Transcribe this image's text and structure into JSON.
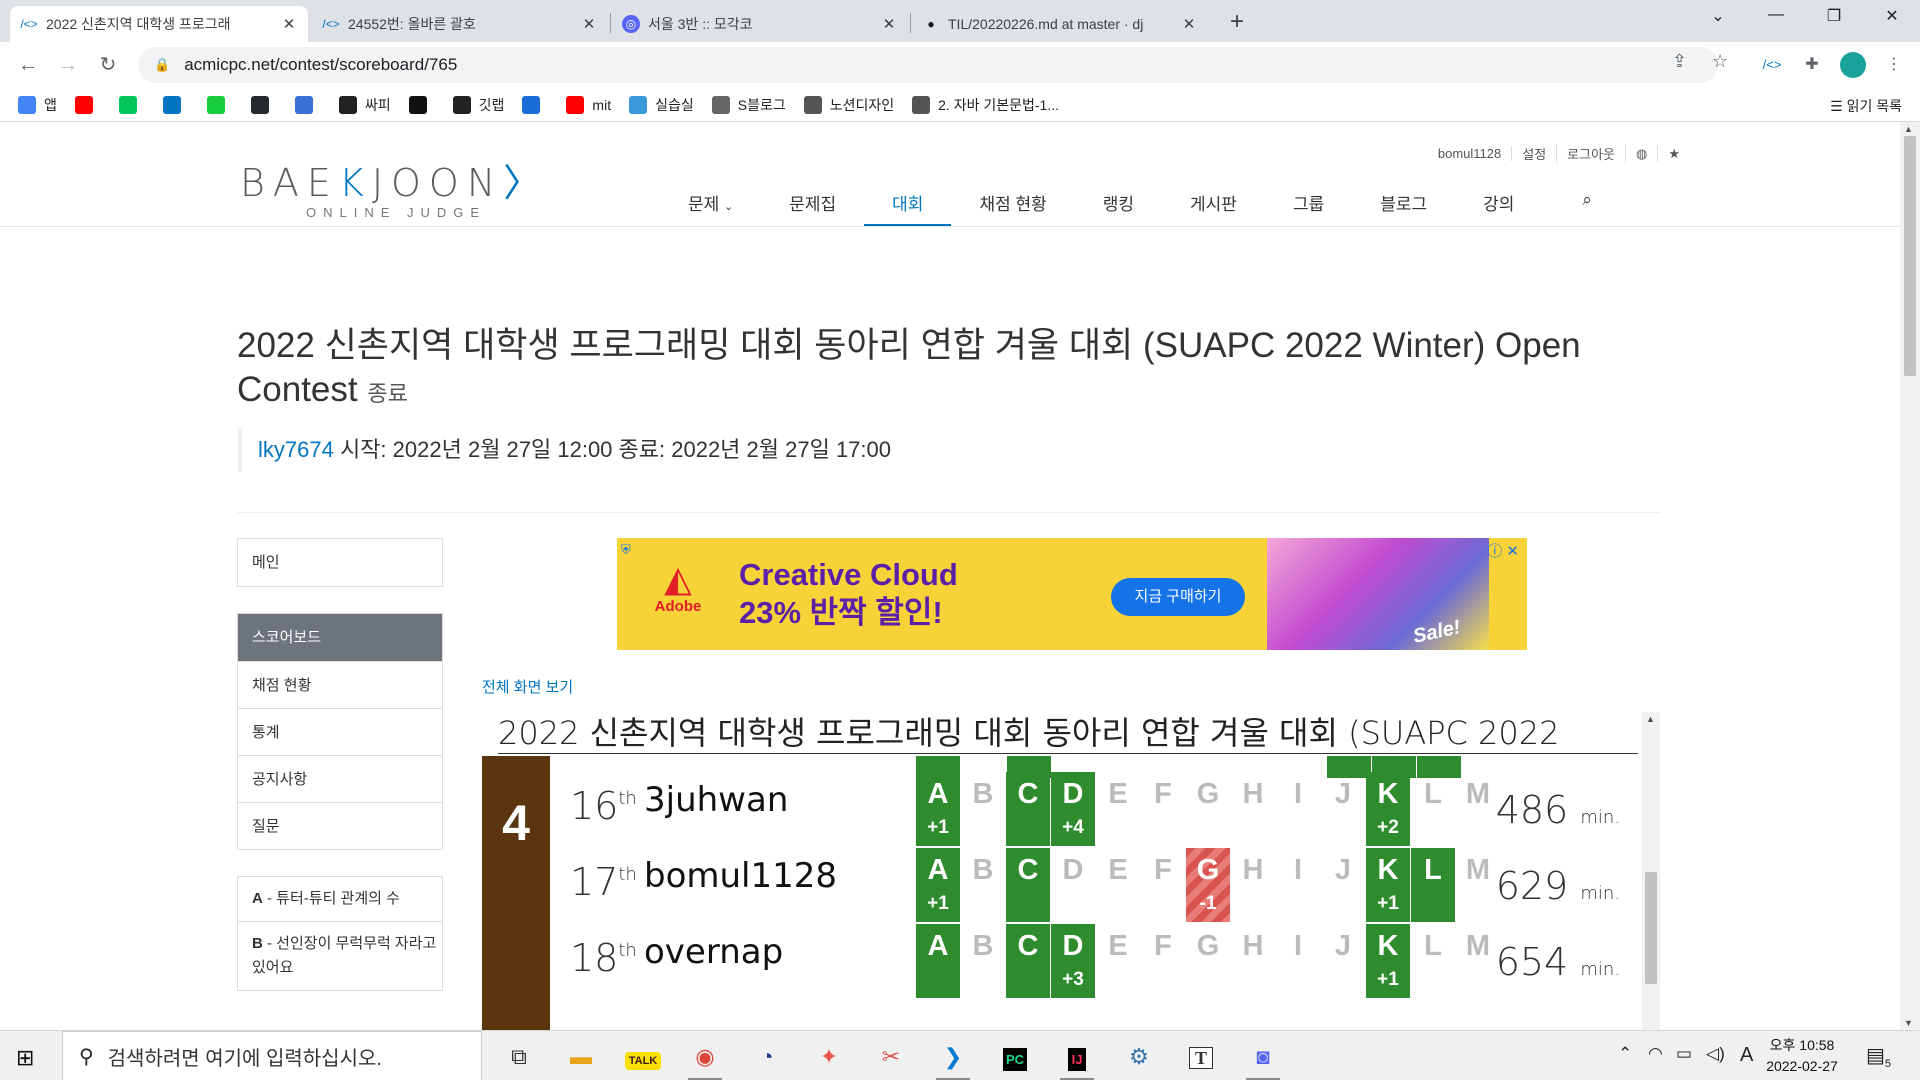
{
  "browser": {
    "tabs": [
      {
        "icon": "baekjoon-icon",
        "title": "2022 신촌지역 대학생 프로그래",
        "active": true
      },
      {
        "icon": "baekjoon-icon",
        "title": "24552번: 올바른 괄호",
        "active": false
      },
      {
        "icon": "discord-icon",
        "title": "서울 3반 :: 모각코",
        "active": false
      },
      {
        "icon": "github-icon",
        "title": "TIL/20220226.md at master · dj",
        "active": false
      }
    ],
    "url": "acmicpc.net/contest/scoreboard/765",
    "bookmarks": [
      {
        "icon": "apps-grid-icon",
        "label": "앱",
        "color": "#4285f4"
      },
      {
        "icon": "youtube-icon",
        "label": "",
        "color": "#ff0000"
      },
      {
        "icon": "naver-icon",
        "label": "",
        "color": "#03c75a"
      },
      {
        "icon": "baekjoon-icon",
        "label": "",
        "color": "#0076c0"
      },
      {
        "icon": "ac-icon",
        "label": "",
        "color": "#17ce3a"
      },
      {
        "icon": "github-icon",
        "label": "",
        "color": "#24292e"
      },
      {
        "icon": "s-blue-icon",
        "label": "",
        "color": "#3a6fd8"
      },
      {
        "icon": "s-dark-icon",
        "label": "싸피",
        "color": "#222"
      },
      {
        "icon": "notion-icon",
        "label": "",
        "color": "#111"
      },
      {
        "icon": "s-dark-icon",
        "label": "깃랩",
        "color": "#222"
      },
      {
        "icon": "webex-icon",
        "label": "",
        "color": "#1b6cd6"
      },
      {
        "icon": "youtube-icon",
        "label": "mit",
        "color": "#ff0000"
      },
      {
        "icon": "s-blue-icon",
        "label": "실습실",
        "color": "#3a9ad9"
      },
      {
        "icon": "settings-outline-icon",
        "label": "S블로그",
        "color": "#666"
      },
      {
        "icon": "pen-icon",
        "label": "노션디자인",
        "color": "#555"
      },
      {
        "icon": "globe-icon",
        "label": "2. 자바 기본문법-1...",
        "color": "#555"
      }
    ],
    "reading_list": "읽기 목록"
  },
  "site": {
    "logo_main_left": "BAE",
    "logo_main_mark": "K",
    "logo_main_right": "JOON",
    "logo_sub": "ONLINE JUDGE",
    "top_links": [
      "bomul1128",
      "설정",
      "로그아웃"
    ],
    "nav": [
      "문제",
      "문제집",
      "대회",
      "채점 현황",
      "랭킹",
      "게시판",
      "그룹",
      "블로그",
      "강의"
    ],
    "nav_active": "대회"
  },
  "contest": {
    "title": "2022 신촌지역 대학생 프로그래밍 대회 동아리 연합 겨울 대회 (SUAPC 2022 Winter) Open Contest",
    "status": "종료",
    "author": "lky7674",
    "meta": " 시작: 2022년 2월 27일 12:00 종료: 2022년 2월 27일 17:00"
  },
  "sidebar": {
    "group1": [
      "메인"
    ],
    "group2": [
      "스코어보드",
      "채점 현황",
      "통계",
      "공지사항",
      "질문"
    ],
    "group2_active": "스코어보드",
    "problems": [
      {
        "id": "A",
        "title": " - 튜터-튜티 관계의 수"
      },
      {
        "id": "B",
        "title": " - 선인장이 무럭무럭 자라고 있어요"
      }
    ]
  },
  "ad": {
    "brand": "Adobe",
    "line1": "Creative Cloud",
    "line2": "23% 반짝 할인!",
    "cta": "지금 구매하기",
    "art_text": "Sale!"
  },
  "scoreboard": {
    "fullview": "전체 화면 보기",
    "title": "2022 신촌지역 대학생 프로그래밍 대회 동아리 연합 겨울 대회 (SUAPC 2022",
    "rank_group": "4",
    "problems": [
      "A",
      "B",
      "C",
      "D",
      "E",
      "F",
      "G",
      "H",
      "I",
      "J",
      "K",
      "L",
      "M"
    ],
    "rows": [
      {
        "place": "16",
        "suffix": "th",
        "name": "3juhwan",
        "penalty": "486",
        "unit": "min.",
        "cells": {
          "A": {
            "s": "ok",
            "sub": "+1"
          },
          "C": {
            "s": "ok",
            "sub": ""
          },
          "D": {
            "s": "ok",
            "sub": "+4"
          },
          "K": {
            "s": "ok",
            "sub": "+2"
          }
        }
      },
      {
        "place": "17",
        "suffix": "th",
        "name": "bomul1128",
        "penalty": "629",
        "unit": "min.",
        "cells": {
          "A": {
            "s": "ok",
            "sub": "+1"
          },
          "C": {
            "s": "ok",
            "sub": ""
          },
          "G": {
            "s": "bad",
            "sub": "-1"
          },
          "K": {
            "s": "ok",
            "sub": "+1"
          },
          "L": {
            "s": "ok",
            "sub": ""
          }
        }
      },
      {
        "place": "18",
        "suffix": "th",
        "name": "overnap",
        "penalty": "654",
        "unit": "min.",
        "cells": {
          "A": {
            "s": "ok",
            "sub": ""
          },
          "C": {
            "s": "ok",
            "sub": ""
          },
          "D": {
            "s": "ok",
            "sub": "+3"
          },
          "K": {
            "s": "ok",
            "sub": "+1"
          }
        }
      }
    ]
  },
  "taskbar": {
    "search_placeholder": "검색하려면 여기에 입력하십시오.",
    "ime": "A",
    "time": "오후 10:58",
    "date": "2022-02-27",
    "notif_count": "5"
  }
}
